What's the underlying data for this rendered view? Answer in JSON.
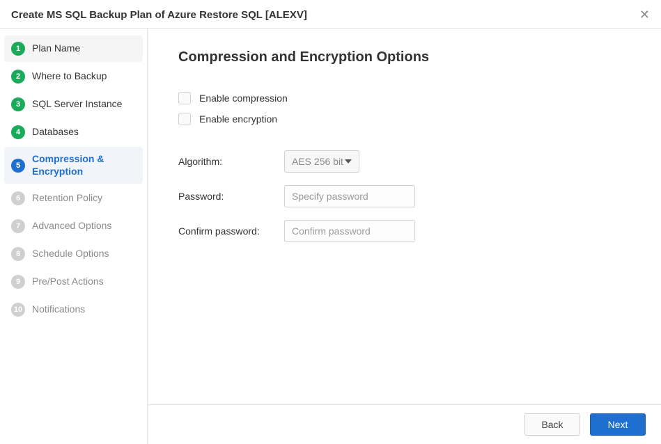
{
  "window": {
    "title": "Create MS SQL Backup Plan of Azure Restore SQL [ALEXV]"
  },
  "sidebar": {
    "steps": [
      {
        "num": "1",
        "label": "Plan Name",
        "state": "done"
      },
      {
        "num": "2",
        "label": "Where to Backup",
        "state": "done"
      },
      {
        "num": "3",
        "label": "SQL Server Instance",
        "state": "done"
      },
      {
        "num": "4",
        "label": "Databases",
        "state": "done"
      },
      {
        "num": "5",
        "label": "Compression & Encryption",
        "state": "current"
      },
      {
        "num": "6",
        "label": "Retention Policy",
        "state": "pending"
      },
      {
        "num": "7",
        "label": "Advanced Options",
        "state": "pending"
      },
      {
        "num": "8",
        "label": "Schedule Options",
        "state": "pending"
      },
      {
        "num": "9",
        "label": "Pre/Post Actions",
        "state": "pending"
      },
      {
        "num": "10",
        "label": "Notifications",
        "state": "pending"
      }
    ]
  },
  "page": {
    "heading": "Compression and Encryption Options",
    "enable_compression_label": "Enable compression",
    "enable_encryption_label": "Enable encryption",
    "algorithm_label": "Algorithm:",
    "algorithm_value": "AES 256 bit",
    "password_label": "Password:",
    "password_placeholder": "Specify password",
    "confirm_label": "Confirm password:",
    "confirm_placeholder": "Confirm password"
  },
  "footer": {
    "back_label": "Back",
    "next_label": "Next"
  }
}
